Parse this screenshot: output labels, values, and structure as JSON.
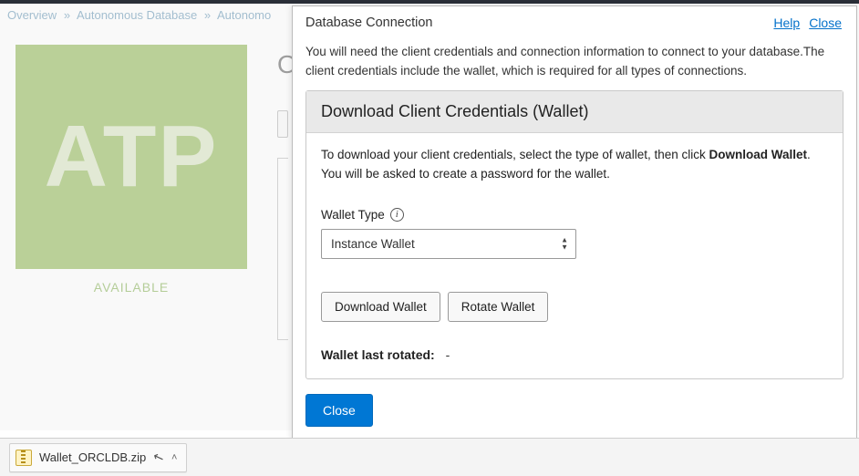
{
  "breadcrumb": {
    "overview": "Overview",
    "ad": "Autonomous Database",
    "cut": "Autonomo"
  },
  "atp": {
    "badge": "ATP",
    "status": "AVAILABLE"
  },
  "main": {
    "cut_heading": "O"
  },
  "modal": {
    "title": "Database Connection",
    "help": "Help",
    "close_link": "Close",
    "description": "You will need the client credentials and connection information to connect to your database.The client credentials include the wallet, which is required for all types of connections.",
    "wallet": {
      "header": "Download Client Credentials (Wallet)",
      "instructions_pre": "To download your client credentials, select the type of wallet, then click ",
      "instructions_bold": "Download Wallet",
      "instructions_post": ". You will be asked to create a password for the wallet.",
      "type_label": "Wallet Type",
      "selected": "Instance Wallet",
      "download_btn": "Download Wallet",
      "rotate_btn": "Rotate Wallet",
      "last_label": "Wallet last rotated:",
      "last_value": "-"
    },
    "close_btn": "Close"
  },
  "download": {
    "filename": "Wallet_ORCLDB.zip"
  }
}
